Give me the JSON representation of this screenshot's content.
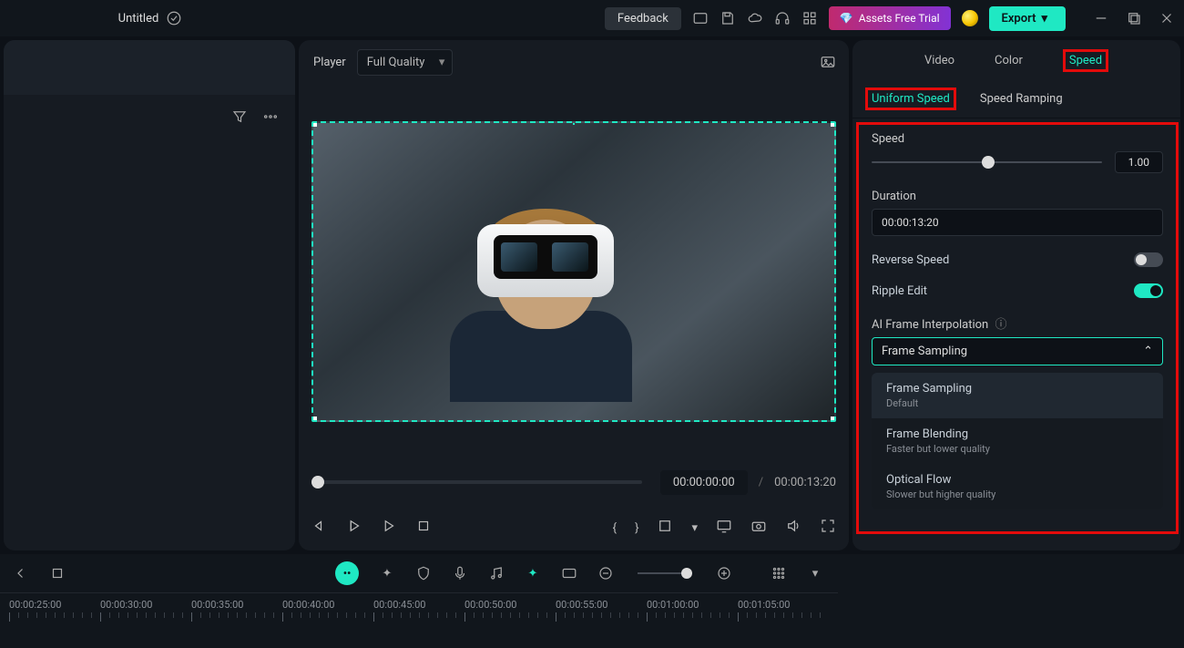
{
  "topbar": {
    "title": "Untitled",
    "feedback": "Feedback",
    "assets_trial": "Assets Free Trial",
    "export": "Export"
  },
  "player": {
    "label": "Player",
    "quality": "Full Quality",
    "current_time": "00:00:00:00",
    "separator": "/",
    "total_time": "00:00:13:20"
  },
  "right": {
    "tabs": {
      "video": "Video",
      "color": "Color",
      "speed": "Speed"
    },
    "sub_tabs": {
      "uniform": "Uniform Speed",
      "ramping": "Speed Ramping"
    },
    "speed_label": "Speed",
    "speed_value": "1.00",
    "duration_label": "Duration",
    "duration_value": "00:00:13:20",
    "reverse_label": "Reverse Speed",
    "ripple_label": "Ripple Edit",
    "ai_interp_label": "AI Frame Interpolation",
    "select_value": "Frame Sampling",
    "dropdown": [
      {
        "title": "Frame Sampling",
        "sub": "Default"
      },
      {
        "title": "Frame Blending",
        "sub": "Faster but lower quality"
      },
      {
        "title": "Optical Flow",
        "sub": "Slower but higher quality"
      }
    ]
  },
  "timeline": {
    "labels": [
      "00:00:25:00",
      "00:00:30:00",
      "00:00:35:00",
      "00:00:40:00",
      "00:00:45:00",
      "00:00:50:00",
      "00:00:55:00",
      "00:01:00:00",
      "00:01:05:00"
    ]
  }
}
